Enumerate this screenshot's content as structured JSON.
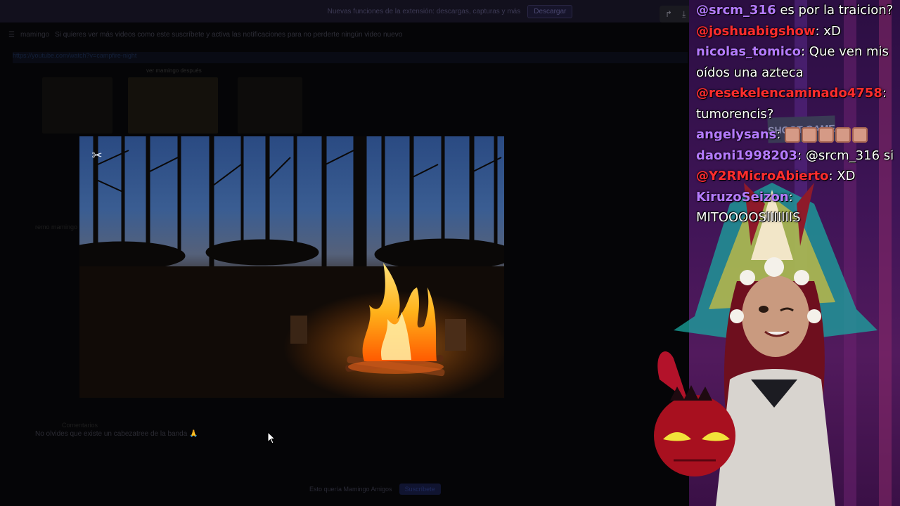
{
  "banner": {
    "message": "Nuevas funciones de la extensión: descargas, capturas y más",
    "button": "Descargar"
  },
  "address": {
    "title": "mamingo",
    "page_text": "Si quieres ver más videos como este suscríbete y activa las notificaciones para no perderte ningún video nuevo",
    "url": "https://youtube.com/watch?v=campfire-night"
  },
  "background_page": {
    "thumb_caption": "ver mamingo después",
    "sidebar_items": [
      "remo mamingo",
      "Comentarios"
    ],
    "comment": "No olvides que existe un cabezatree de la banda 🙏",
    "footer_text": "Esto quería Mamingo Amigos",
    "footer_button": "Suscríbete"
  },
  "toolbar": {
    "icons": [
      "share-icon",
      "download-icon",
      "more-icon",
      "fullscreen-icon"
    ]
  },
  "video": {
    "app_logo": "capcut-logo",
    "scene": "campfire in a forest at dusk"
  },
  "chat": [
    {
      "user": "@srcm_316",
      "color": "#b57bff",
      "message": " es por la traicion?"
    },
    {
      "user": "@joshuabigshow",
      "color": "#ff2d2d",
      "message": ": xD"
    },
    {
      "user": "nicolas_tomico",
      "color": "#b57bff",
      "message": ": Que ven mis oídos una azteca"
    },
    {
      "user": "@resekelencaminado4758",
      "color": "#ff2d2d",
      "message": ": tumorencis?"
    },
    {
      "user": "angelysans",
      "color": "#b57bff",
      "message": ": ",
      "emotes": 5
    },
    {
      "user": "daoni1998203",
      "color": "#b57bff",
      "message": ": @srcm_316 si"
    },
    {
      "user": "@Y2RMicroAbierto",
      "color": "#ff2d2d",
      "message": ": XD"
    },
    {
      "user": "KiruzoSeizon",
      "color": "#b57bff",
      "message": ": MITOOOOSIIIIIIIS"
    }
  ],
  "overlay": {
    "sign": "SHOOT GAME"
  },
  "colors": {
    "chat_purple": "#b57bff",
    "chat_red": "#ff2d2d",
    "overlay_bg": "#3e1456"
  }
}
